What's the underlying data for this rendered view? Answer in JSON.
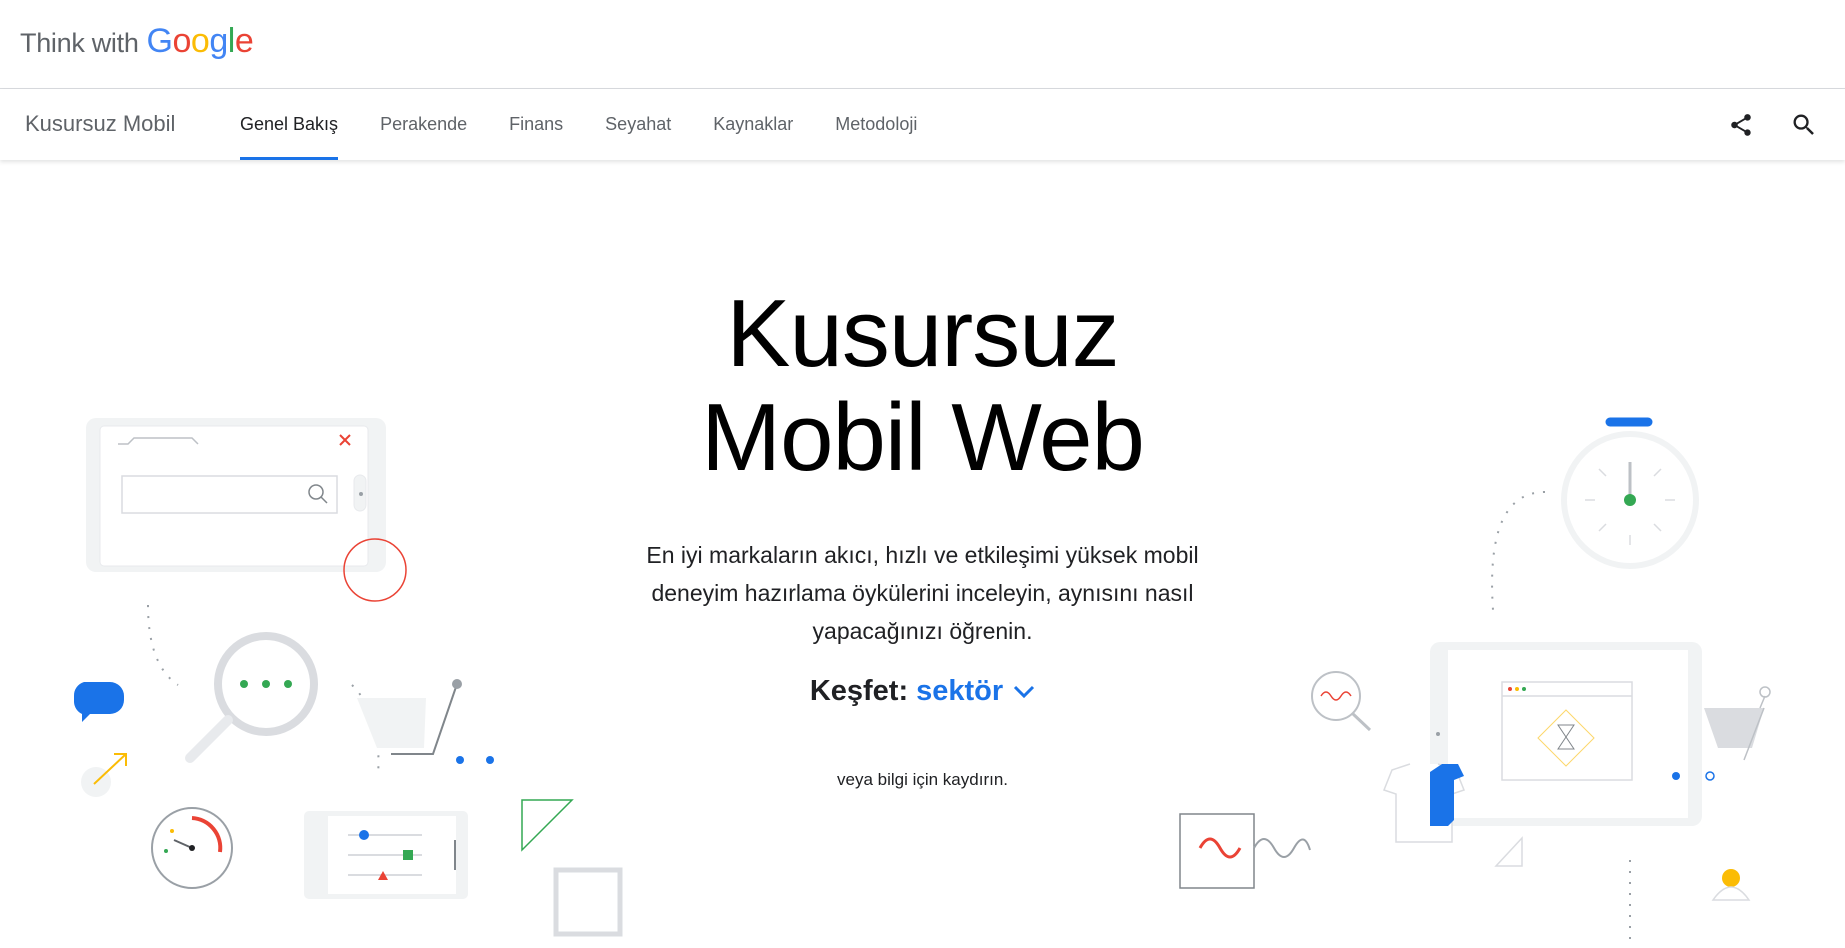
{
  "brand": {
    "think": "Think with",
    "google_letters": [
      {
        "ch": "G",
        "color": "#4285F4"
      },
      {
        "ch": "o",
        "color": "#EA4335"
      },
      {
        "ch": "o",
        "color": "#FBBC05"
      },
      {
        "ch": "g",
        "color": "#4285F4"
      },
      {
        "ch": "l",
        "color": "#34A853"
      },
      {
        "ch": "e",
        "color": "#EA4335"
      }
    ]
  },
  "subnav": {
    "section_title": "Kusursuz Mobil",
    "tabs": [
      {
        "label": "Genel Bakış",
        "active": true
      },
      {
        "label": "Perakende",
        "active": false
      },
      {
        "label": "Finans",
        "active": false
      },
      {
        "label": "Seyahat",
        "active": false
      },
      {
        "label": "Kaynaklar",
        "active": false
      },
      {
        "label": "Metodoloji",
        "active": false
      }
    ],
    "icons": [
      "share-icon",
      "search-icon"
    ]
  },
  "hero": {
    "title_line1": "Kusursuz",
    "title_line2": "Mobil Web",
    "description_lines": [
      "En iyi markaların akıcı, hızlı ve etkileşimi yüksek mobil",
      "deneyim hazırlama öykülerini inceleyin, aynısını nasıl",
      "yapacağınızı öğrenin."
    ],
    "explore_label": "Keşfet:",
    "explore_value": "sektör",
    "scroll_hint": "veya bilgi için kaydırın."
  },
  "colors": {
    "accent": "#1a73e8",
    "red": "#EA4335",
    "green": "#34A853",
    "yellow": "#FBBC05",
    "grey": "#dadce0"
  }
}
